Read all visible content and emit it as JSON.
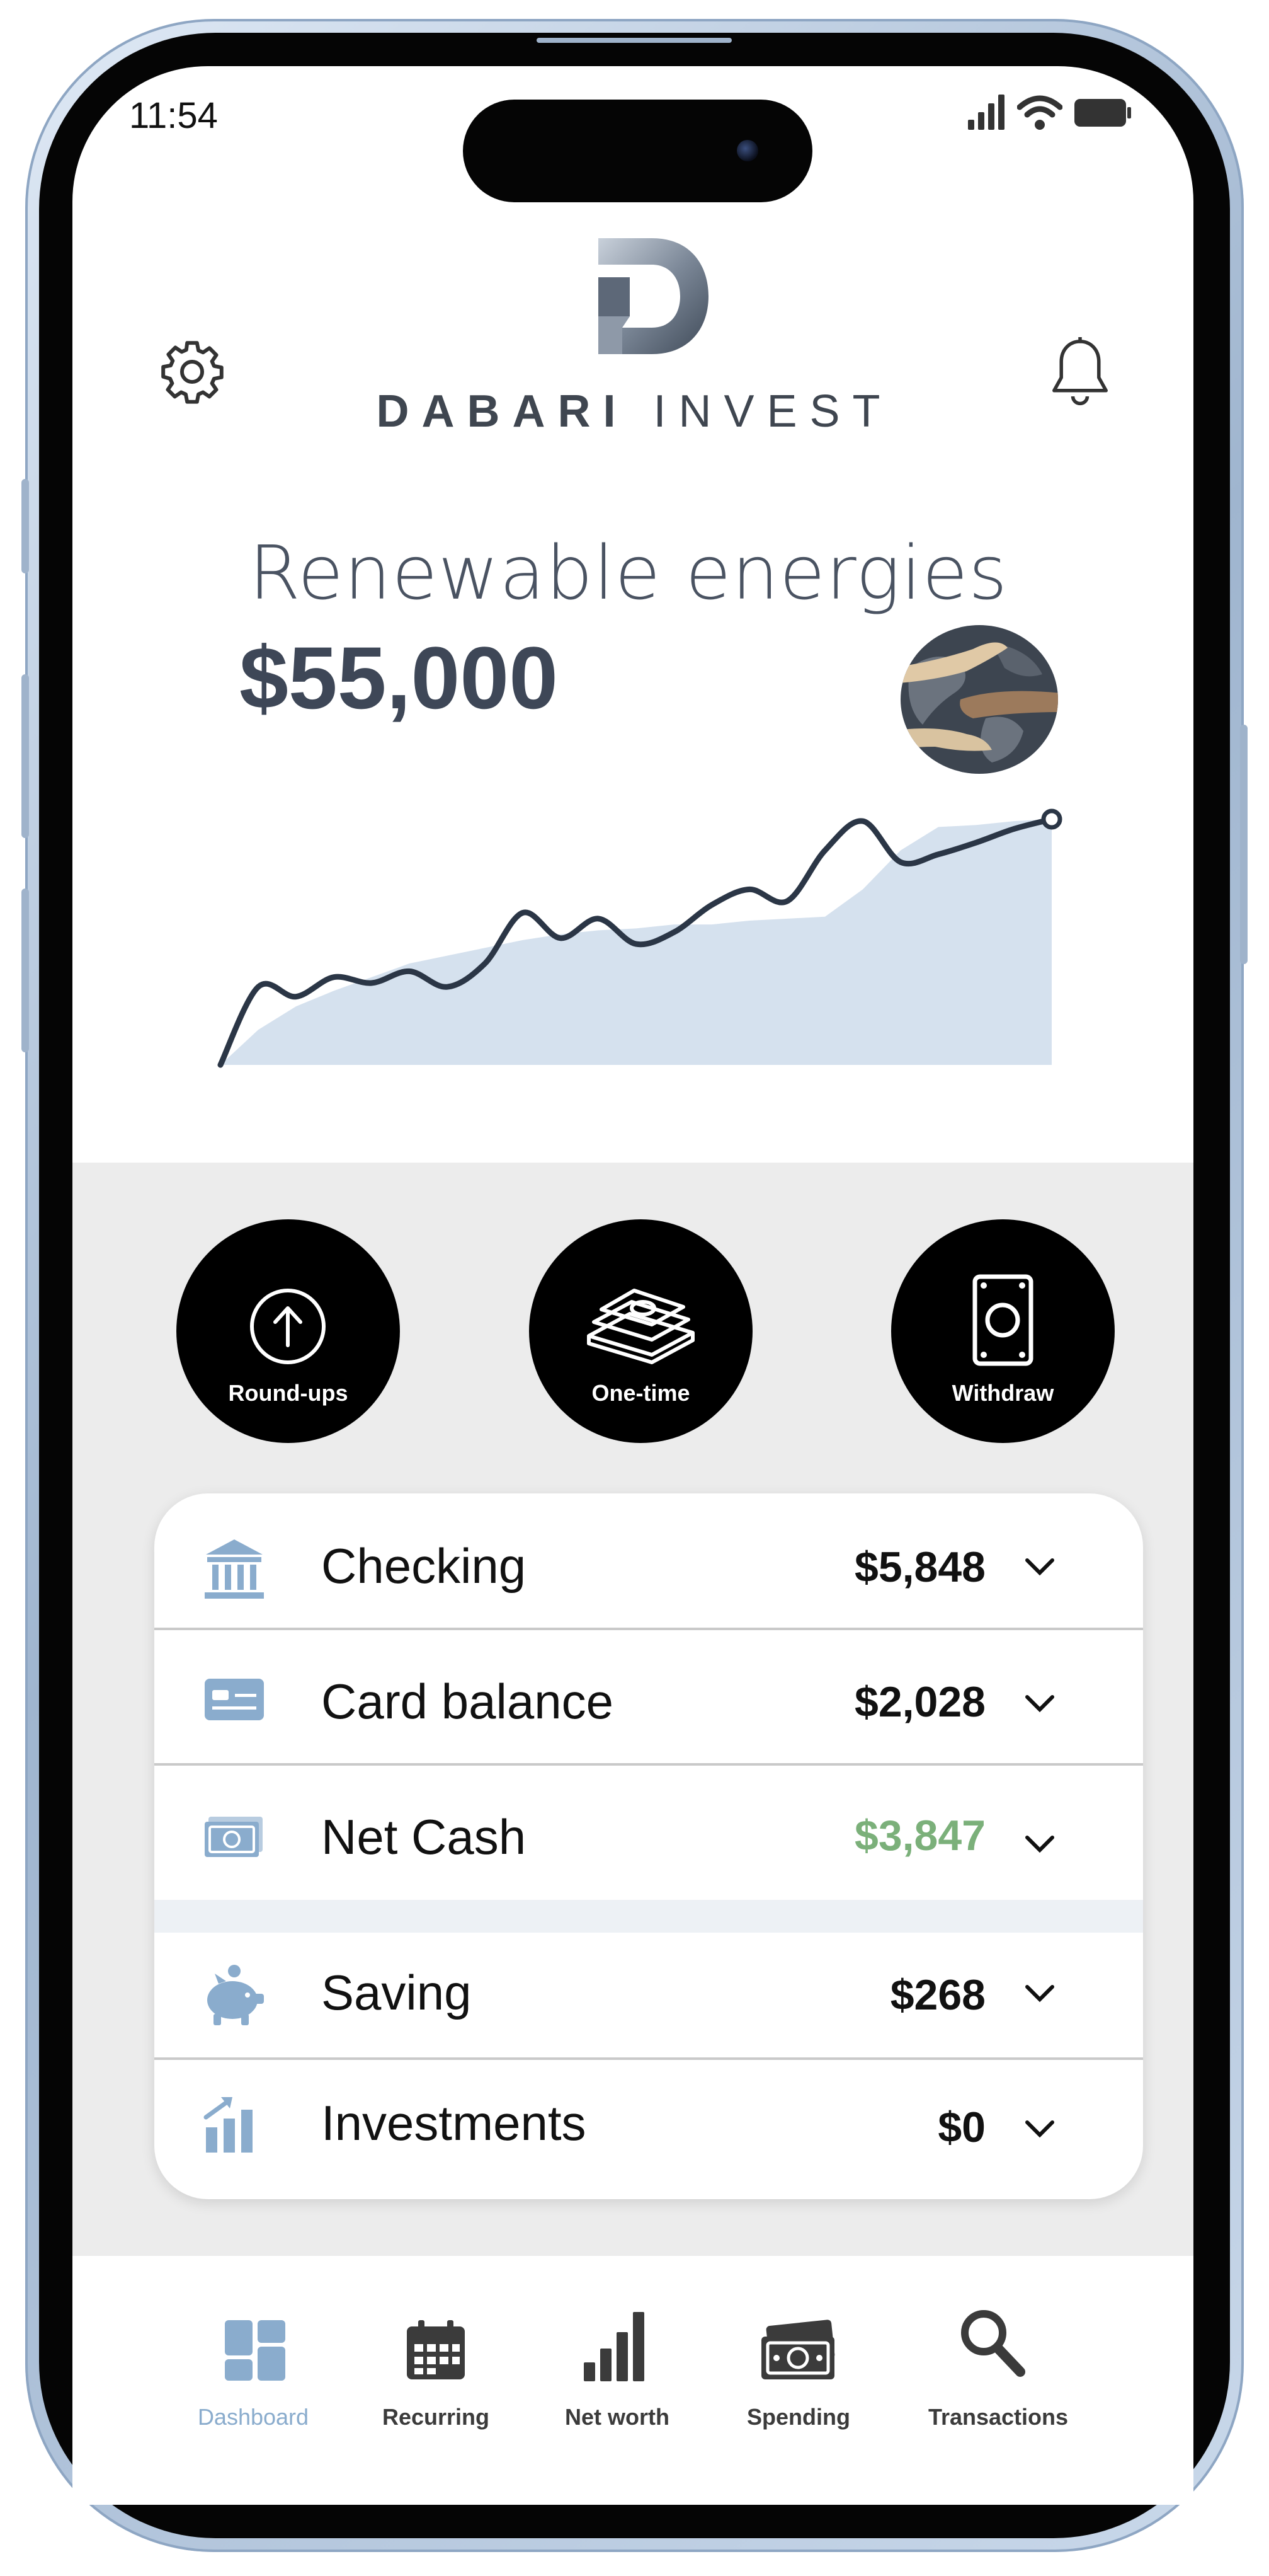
{
  "status_bar": {
    "time": "11:54"
  },
  "header": {
    "brand_bold": "DABARI",
    "brand_light": "INVEST",
    "settings_icon": "gear-icon",
    "notification_icon": "bell-icon"
  },
  "hero": {
    "title": "Renewable energies",
    "value": "$55,000",
    "image_icon": "globe-with-hands-icon"
  },
  "chart_data": {
    "type": "line",
    "series": [
      {
        "values": [
          0,
          40,
          35,
          45,
          42,
          48,
          40,
          52,
          78,
          65,
          75,
          62,
          68,
          82,
          90,
          84,
          110,
          125,
          104,
          108,
          114,
          121,
          126
        ]
      }
    ],
    "area": {
      "values": [
        0,
        18,
        30,
        38,
        45,
        52,
        56,
        60,
        64,
        67,
        69,
        70,
        72,
        72,
        74,
        75,
        76,
        90,
        110,
        122,
        123,
        125,
        126
      ]
    }
  },
  "actions": [
    {
      "label": "Round-ups",
      "icon": "arrow-up-circle-icon"
    },
    {
      "label": "One-time",
      "icon": "cash-stack-icon"
    },
    {
      "label": "Withdraw",
      "icon": "bill-icon"
    }
  ],
  "accounts": [
    {
      "label": "Checking",
      "value": "$5,848",
      "icon": "bank-icon"
    },
    {
      "label": "Card balance",
      "value": "$2,028",
      "icon": "credit-card-icon"
    },
    {
      "label": "Net Cash",
      "value": "$3,847",
      "icon": "money-icon"
    },
    {
      "label": "Saving",
      "value": "$268",
      "icon": "piggy-bank-icon"
    },
    {
      "label": "Investments",
      "value": "$0",
      "icon": "growth-chart-icon"
    }
  ],
  "colors": {
    "accent": "#8aaccd",
    "positive": "#7bb07a",
    "dark_text": "#3e4757",
    "area_fill": "#d5e1ee",
    "line": "#2b3646"
  },
  "nav": [
    {
      "label": "Dashboard",
      "icon": "dashboard-icon",
      "active": true
    },
    {
      "label": "Recurring",
      "icon": "calendar-icon",
      "active": false
    },
    {
      "label": "Net worth",
      "icon": "bar-chart-icon",
      "active": false
    },
    {
      "label": "Spending",
      "icon": "cash-icon",
      "active": false
    },
    {
      "label": "Transactions",
      "icon": "search-icon",
      "active": false
    }
  ]
}
